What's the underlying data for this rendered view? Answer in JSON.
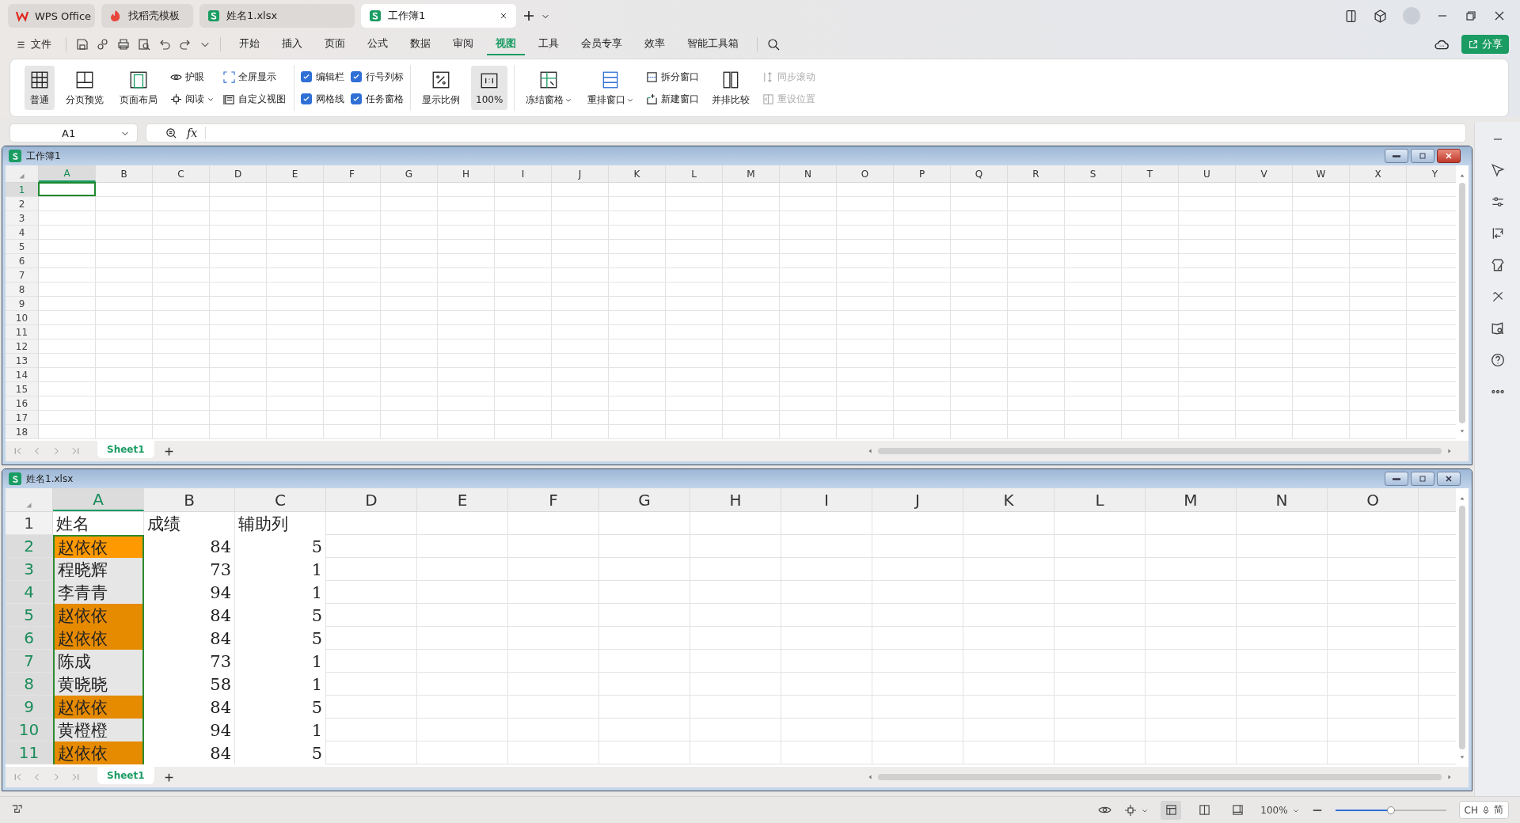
{
  "tabs": [
    {
      "kind": "home",
      "label": "WPS Office",
      "selected": false
    },
    {
      "kind": "template",
      "label": "找稻壳模板",
      "selected": false
    },
    {
      "kind": "sheet",
      "label": "姓名1.xlsx",
      "selected": false
    },
    {
      "kind": "sheet",
      "label": "工作簿1",
      "selected": true
    }
  ],
  "menu": {
    "file": "文件",
    "items": [
      {
        "label": "开始",
        "selected": false
      },
      {
        "label": "插入",
        "selected": false
      },
      {
        "label": "页面",
        "selected": false
      },
      {
        "label": "公式",
        "selected": false
      },
      {
        "label": "数据",
        "selected": false
      },
      {
        "label": "审阅",
        "selected": false
      },
      {
        "label": "视图",
        "selected": true
      },
      {
        "label": "工具",
        "selected": false
      },
      {
        "label": "会员专享",
        "selected": false
      },
      {
        "label": "效率",
        "selected": false
      },
      {
        "label": "智能工具箱",
        "selected": false
      }
    ],
    "share": "分享"
  },
  "ribbon": {
    "groups": [
      {
        "columns": [
          [
            {
              "kind": "big",
              "label": "普通",
              "selected": true,
              "dropdown": false
            }
          ],
          [
            {
              "kind": "big",
              "label": "分页预览",
              "selected": false,
              "dropdown": false
            }
          ],
          [
            {
              "kind": "big",
              "label": "页面布局",
              "selected": false,
              "dropdown": false
            }
          ],
          [
            {
              "kind": "small",
              "label": "护眼",
              "dropdown": false,
              "disabled": false
            },
            {
              "kind": "small",
              "label": "阅读",
              "dropdown": true,
              "disabled": false
            }
          ],
          [
            {
              "kind": "small",
              "label": "全屏显示",
              "dropdown": false,
              "disabled": false
            },
            {
              "kind": "small",
              "label": "自定义视图",
              "dropdown": false,
              "disabled": false
            }
          ]
        ]
      },
      {
        "columns": [
          [
            {
              "kind": "check",
              "label": "编辑栏",
              "checked": true
            },
            {
              "kind": "check",
              "label": "网格线",
              "checked": true
            }
          ],
          [
            {
              "kind": "check",
              "label": "行号列标",
              "checked": true
            },
            {
              "kind": "check",
              "label": "任务窗格",
              "checked": true
            }
          ]
        ]
      },
      {
        "columns": [
          [
            {
              "kind": "big",
              "label": "显示比例",
              "selected": false,
              "dropdown": false
            }
          ],
          [
            {
              "kind": "big",
              "label": "100%",
              "selected": true,
              "dropdown": false
            }
          ]
        ]
      },
      {
        "columns": [
          [
            {
              "kind": "big",
              "label": "冻结窗格",
              "selected": false,
              "dropdown": true
            }
          ],
          [
            {
              "kind": "big",
              "label": "重排窗口",
              "selected": false,
              "dropdown": true
            }
          ],
          [
            {
              "kind": "small",
              "label": "拆分窗口",
              "dropdown": false,
              "disabled": false
            },
            {
              "kind": "small",
              "label": "新建窗口",
              "dropdown": false,
              "disabled": false
            }
          ],
          [
            {
              "kind": "big",
              "label": "并排比较",
              "selected": false,
              "dropdown": false
            }
          ],
          [
            {
              "kind": "small",
              "label": "同步滚动",
              "dropdown": false,
              "disabled": true
            },
            {
              "kind": "small",
              "label": "重设位置",
              "dropdown": false,
              "disabled": true
            }
          ]
        ]
      }
    ]
  },
  "formula_bar": {
    "cell_ref": "A1",
    "fx": "fx"
  },
  "windows": [
    {
      "title": "工作簿1",
      "active": true,
      "columns": [
        {
          "label": "A",
          "selected": true
        },
        {
          "label": "B",
          "selected": false
        },
        {
          "label": "C",
          "selected": false
        },
        {
          "label": "D",
          "selected": false
        },
        {
          "label": "E",
          "selected": false
        },
        {
          "label": "F",
          "selected": false
        },
        {
          "label": "G",
          "selected": false
        },
        {
          "label": "H",
          "selected": false
        },
        {
          "label": "I",
          "selected": false
        },
        {
          "label": "J",
          "selected": false
        },
        {
          "label": "K",
          "selected": false
        },
        {
          "label": "L",
          "selected": false
        },
        {
          "label": "M",
          "selected": false
        },
        {
          "label": "N",
          "selected": false
        },
        {
          "label": "O",
          "selected": false
        },
        {
          "label": "P",
          "selected": false
        },
        {
          "label": "Q",
          "selected": false
        },
        {
          "label": "R",
          "selected": false
        },
        {
          "label": "S",
          "selected": false
        },
        {
          "label": "T",
          "selected": false
        },
        {
          "label": "U",
          "selected": false
        },
        {
          "label": "V",
          "selected": false
        },
        {
          "label": "W",
          "selected": false
        },
        {
          "label": "X",
          "selected": false
        },
        {
          "label": "Y",
          "selected": false
        }
      ],
      "rows": [
        {
          "label": "1",
          "selected": true
        },
        {
          "label": "2",
          "selected": false
        },
        {
          "label": "3",
          "selected": false
        },
        {
          "label": "4",
          "selected": false
        },
        {
          "label": "5",
          "selected": false
        },
        {
          "label": "6",
          "selected": false
        },
        {
          "label": "7",
          "selected": false
        },
        {
          "label": "8",
          "selected": false
        },
        {
          "label": "9",
          "selected": false
        },
        {
          "label": "10",
          "selected": false
        },
        {
          "label": "11",
          "selected": false
        },
        {
          "label": "12",
          "selected": false
        },
        {
          "label": "13",
          "selected": false
        },
        {
          "label": "14",
          "selected": false
        },
        {
          "label": "15",
          "selected": false
        },
        {
          "label": "16",
          "selected": false
        },
        {
          "label": "17",
          "selected": false
        },
        {
          "label": "18",
          "selected": false
        }
      ],
      "sheet_tabs": [
        {
          "label": "Sheet1",
          "selected": true
        }
      ]
    },
    {
      "title": "姓名1.xlsx",
      "active": false,
      "columns": [
        {
          "label": "A",
          "selected": true
        },
        {
          "label": "B",
          "selected": false
        },
        {
          "label": "C",
          "selected": false
        },
        {
          "label": "D",
          "selected": false
        },
        {
          "label": "E",
          "selected": false
        },
        {
          "label": "F",
          "selected": false
        },
        {
          "label": "G",
          "selected": false
        },
        {
          "label": "H",
          "selected": false
        },
        {
          "label": "I",
          "selected": false
        },
        {
          "label": "J",
          "selected": false
        },
        {
          "label": "K",
          "selected": false
        },
        {
          "label": "L",
          "selected": false
        },
        {
          "label": "M",
          "selected": false
        },
        {
          "label": "N",
          "selected": false
        },
        {
          "label": "O",
          "selected": false
        }
      ],
      "rows": [
        {
          "label": "1",
          "kind": "header",
          "selected": false,
          "active": false,
          "highlighted": false,
          "cells": [
            "姓名",
            "成绩",
            "辅助列"
          ]
        },
        {
          "label": "2",
          "kind": "data",
          "selected": true,
          "active": true,
          "highlighted": true,
          "cells": [
            "赵依依",
            "84",
            "5"
          ]
        },
        {
          "label": "3",
          "kind": "data",
          "selected": true,
          "active": false,
          "highlighted": false,
          "cells": [
            "程晓辉",
            "73",
            "1"
          ]
        },
        {
          "label": "4",
          "kind": "data",
          "selected": true,
          "active": false,
          "highlighted": false,
          "cells": [
            "李青青",
            "94",
            "1"
          ]
        },
        {
          "label": "5",
          "kind": "data",
          "selected": true,
          "active": false,
          "highlighted": true,
          "cells": [
            "赵依依",
            "84",
            "5"
          ]
        },
        {
          "label": "6",
          "kind": "data",
          "selected": true,
          "active": false,
          "highlighted": true,
          "cells": [
            "赵依依",
            "84",
            "5"
          ]
        },
        {
          "label": "7",
          "kind": "data",
          "selected": true,
          "active": false,
          "highlighted": false,
          "cells": [
            "陈成",
            "73",
            "1"
          ]
        },
        {
          "label": "8",
          "kind": "data",
          "selected": true,
          "active": false,
          "highlighted": false,
          "cells": [
            "黄晓晓",
            "58",
            "1"
          ]
        },
        {
          "label": "9",
          "kind": "data",
          "selected": true,
          "active": false,
          "highlighted": true,
          "cells": [
            "赵依依",
            "84",
            "5"
          ]
        },
        {
          "label": "10",
          "kind": "data",
          "selected": true,
          "active": false,
          "highlighted": false,
          "cells": [
            "黄橙橙",
            "94",
            "1"
          ]
        },
        {
          "label": "11",
          "kind": "data",
          "selected": true,
          "active": false,
          "highlighted": true,
          "cells": [
            "赵依依",
            "84",
            "5"
          ]
        }
      ],
      "sheet_tabs": [
        {
          "label": "Sheet1",
          "selected": true
        }
      ]
    }
  ],
  "status_bar": {
    "views": [
      {
        "selected": true
      },
      {
        "selected": false
      },
      {
        "selected": false
      }
    ],
    "zoom": "100%",
    "zoom_slider": {
      "level": 0.5
    },
    "ime": {
      "lang": "CH",
      "mode": "简"
    }
  }
}
